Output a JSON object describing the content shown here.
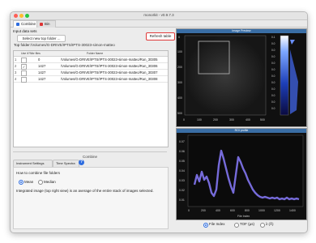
{
  "window": {
    "title": "monorkit - v0.9.7.3"
  },
  "tabs": [
    {
      "label": "Combine"
    },
    {
      "label": "Bin"
    }
  ],
  "input": {
    "section_label": "Input data sets",
    "select_button": "Select new top folder ...",
    "refresh_button": "Refresh table",
    "top_folder_label": "Top folder:",
    "top_folder_value": "/Volumes/G-DRIVE/IPTS/IPTS-30023-simon-matteo"
  },
  "table": {
    "headers": [
      "Use it?",
      "Nbr files",
      "Folder Name"
    ],
    "rows": [
      {
        "num": "1",
        "checked": "",
        "files": "0",
        "path": "/Volumes/G-DRIVE/IPTS/IPTS-30023-simon-matteo/Run_30305"
      },
      {
        "num": "2",
        "checked": "✓",
        "files": "1427",
        "path": "/Volumes/G-DRIVE/IPTS/IPTS-30023-simon-matteo/Run_30306"
      },
      {
        "num": "3",
        "checked": "",
        "files": "1427",
        "path": "/Volumes/G-DRIVE/IPTS/IPTS-30023-simon-matteo/Run_30307"
      },
      {
        "num": "4",
        "checked": "",
        "files": "1427",
        "path": "/Volumes/G-DRIVE/IPTS/IPTS-30023-simon-matteo/Run_30308"
      }
    ]
  },
  "combine": {
    "title": "Combine",
    "tabs": [
      {
        "label": "Instrument Settings"
      },
      {
        "label": "Time Spectra"
      }
    ],
    "help_glyph": "?",
    "how_label": "How to combine file folders",
    "options": [
      {
        "label": "Mean",
        "selected": true
      },
      {
        "label": "Median",
        "selected": false
      }
    ],
    "description": "Integrated image (top right view) is an average of the entire stack of images selected."
  },
  "image_preview": {
    "title": "Image Preview",
    "x_ticks": [
      "0",
      "100",
      "200",
      "300",
      "400",
      "500"
    ],
    "y_ticks": [
      "0",
      "100",
      "200",
      "300",
      "400",
      "500"
    ],
    "colorbar_ticks": [
      "0.1",
      "0.0",
      "0.0",
      "0.0",
      "0.0",
      "0.0",
      "0.0",
      "0.0",
      "0.0",
      "0.0",
      "0.0",
      "0.0"
    ]
  },
  "roi_profile": {
    "title": "ROI profile",
    "xlabel": "File Index",
    "x_ticks": [
      "0",
      "200",
      "400",
      "600",
      "800",
      "1000",
      "1200",
      "1400"
    ],
    "y_ticks": [
      "0.07",
      "0.06",
      "0.05",
      "0.04",
      "0.03",
      "0.02",
      "0.01"
    ],
    "x_axis_options": [
      {
        "label": "File Index",
        "selected": true
      },
      {
        "label": "TOF (µs)",
        "selected": false
      },
      {
        "label": "λ (Å)",
        "selected": false
      }
    ]
  },
  "colors": {
    "accent": "#2d6cdf",
    "plot_line": "#8a7cff",
    "highlight_box": "#e03a3a"
  }
}
